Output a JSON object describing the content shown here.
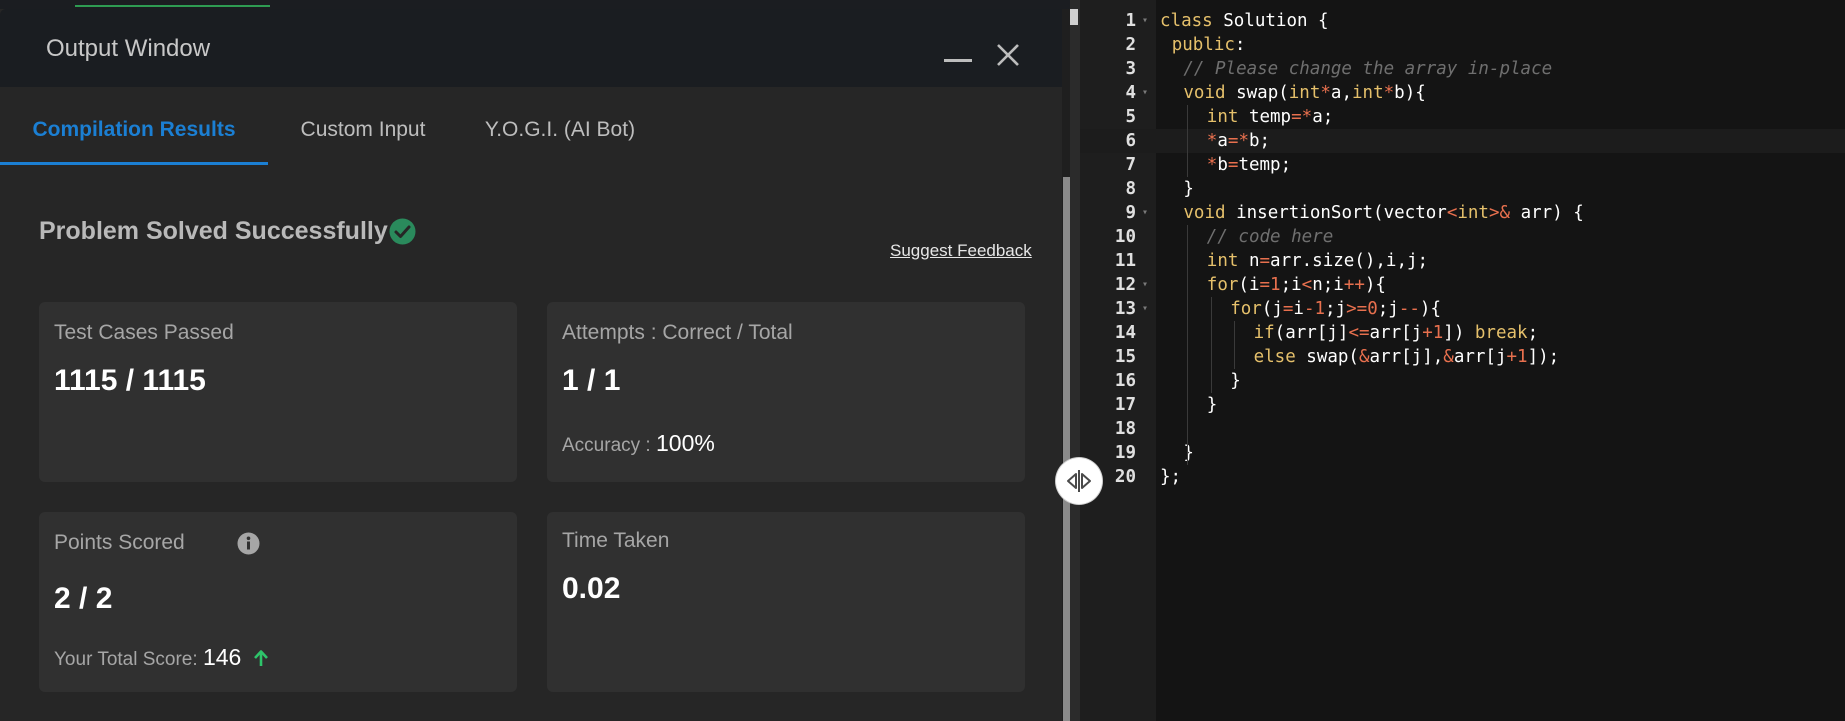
{
  "output_window": {
    "title": "Output Window",
    "tabs": [
      {
        "label": "Compilation Results",
        "active": true
      },
      {
        "label": "Custom Input",
        "active": false
      },
      {
        "label": "Y.O.G.I. (AI Bot)",
        "active": false
      }
    ],
    "status": "Problem Solved Successfully",
    "suggest_feedback": "Suggest Feedback",
    "cards": {
      "tests": {
        "label": "Test Cases Passed",
        "value": "1115 / 1115"
      },
      "attempts": {
        "label": "Attempts : Correct / Total",
        "value": "1 / 1",
        "sub_label": "Accuracy :",
        "sub_value": "100%"
      },
      "points": {
        "label": "Points Scored",
        "value": "2 / 2",
        "sub_label": "Your Total Score:",
        "sub_value": "146"
      },
      "time": {
        "label": "Time Taken",
        "value": "0.02"
      }
    }
  },
  "colors": {
    "accent_blue": "#1b7fd3",
    "success_green": "#2e9b52",
    "keyword": "#e5c06b",
    "operator": "#e8704e",
    "comment": "#6f6f6f"
  },
  "icons": [
    "minimize-icon",
    "close-icon",
    "check-circle-icon",
    "info-icon",
    "arrow-up-icon",
    "resize-handle-icon",
    "fold-arrow-icon"
  ],
  "editor": {
    "active_line": 6,
    "lines": [
      {
        "n": "1",
        "fold": true,
        "indent": 0,
        "tokens": [
          [
            "kw",
            "class"
          ],
          [
            "t",
            " Solution {"
          ]
        ]
      },
      {
        "n": "2",
        "fold": false,
        "indent": 1,
        "tokens": [
          [
            "kw",
            "public"
          ],
          [
            "t",
            ":"
          ]
        ]
      },
      {
        "n": "3",
        "fold": false,
        "indent": 2,
        "tokens": [
          [
            "cm",
            "// Please change the array in-place"
          ]
        ]
      },
      {
        "n": "4",
        "fold": true,
        "indent": 2,
        "tokens": [
          [
            "kw",
            "void"
          ],
          [
            "t",
            " swap("
          ],
          [
            "kw",
            "int"
          ],
          [
            "op",
            "*"
          ],
          [
            "t",
            "a,"
          ],
          [
            "kw",
            "int"
          ],
          [
            "op",
            "*"
          ],
          [
            "t",
            "b){"
          ]
        ]
      },
      {
        "n": "5",
        "fold": false,
        "indent": 4,
        "tokens": [
          [
            "kw",
            "int"
          ],
          [
            "t",
            " temp"
          ],
          [
            "op",
            "="
          ],
          [
            "op",
            "*"
          ],
          [
            "t",
            "a;"
          ]
        ]
      },
      {
        "n": "6",
        "fold": false,
        "indent": 4,
        "tokens": [
          [
            "op",
            "*"
          ],
          [
            "t",
            "a"
          ],
          [
            "op",
            "="
          ],
          [
            "op",
            "*"
          ],
          [
            "t",
            "b;"
          ]
        ]
      },
      {
        "n": "7",
        "fold": false,
        "indent": 4,
        "tokens": [
          [
            "op",
            "*"
          ],
          [
            "t",
            "b"
          ],
          [
            "op",
            "="
          ],
          [
            "t",
            "temp;"
          ]
        ]
      },
      {
        "n": "8",
        "fold": false,
        "indent": 2,
        "tokens": [
          [
            "t",
            "}"
          ]
        ]
      },
      {
        "n": "9",
        "fold": true,
        "indent": 2,
        "tokens": [
          [
            "kw",
            "void"
          ],
          [
            "t",
            " insertionSort(vector"
          ],
          [
            "op",
            "<"
          ],
          [
            "kw",
            "int"
          ],
          [
            "op",
            ">&"
          ],
          [
            "t",
            " arr) {"
          ]
        ]
      },
      {
        "n": "10",
        "fold": false,
        "indent": 4,
        "tokens": [
          [
            "cm",
            "// code here"
          ]
        ]
      },
      {
        "n": "11",
        "fold": false,
        "indent": 4,
        "tokens": [
          [
            "kw",
            "int"
          ],
          [
            "t",
            " n"
          ],
          [
            "op",
            "="
          ],
          [
            "t",
            "arr.size(),i,j;"
          ]
        ]
      },
      {
        "n": "12",
        "fold": true,
        "indent": 4,
        "tokens": [
          [
            "kw",
            "for"
          ],
          [
            "t",
            "(i"
          ],
          [
            "op",
            "="
          ],
          [
            "op",
            "1"
          ],
          [
            "t",
            ";i"
          ],
          [
            "op",
            "<"
          ],
          [
            "t",
            "n;i"
          ],
          [
            "op",
            "++"
          ],
          [
            "t",
            "){"
          ]
        ]
      },
      {
        "n": "13",
        "fold": true,
        "indent": 6,
        "tokens": [
          [
            "kw",
            "for"
          ],
          [
            "t",
            "(j"
          ],
          [
            "op",
            "="
          ],
          [
            "t",
            "i"
          ],
          [
            "op",
            "-1"
          ],
          [
            "t",
            ";j"
          ],
          [
            "op",
            ">="
          ],
          [
            "op",
            "0"
          ],
          [
            "t",
            ";j"
          ],
          [
            "op",
            "--"
          ],
          [
            "t",
            "){"
          ]
        ]
      },
      {
        "n": "14",
        "fold": false,
        "indent": 8,
        "tokens": [
          [
            "kw",
            "if"
          ],
          [
            "t",
            "(arr[j]"
          ],
          [
            "op",
            "<="
          ],
          [
            "t",
            "arr[j"
          ],
          [
            "op",
            "+1"
          ],
          [
            "t",
            "]) "
          ],
          [
            "kw",
            "break"
          ],
          [
            "t",
            ";"
          ]
        ]
      },
      {
        "n": "15",
        "fold": false,
        "indent": 8,
        "tokens": [
          [
            "kw",
            "else"
          ],
          [
            "t",
            " swap("
          ],
          [
            "op",
            "&"
          ],
          [
            "t",
            "arr[j],"
          ],
          [
            "op",
            "&"
          ],
          [
            "t",
            "arr[j"
          ],
          [
            "op",
            "+1"
          ],
          [
            "t",
            "]);"
          ]
        ]
      },
      {
        "n": "16",
        "fold": false,
        "indent": 6,
        "tokens": [
          [
            "t",
            "}"
          ]
        ]
      },
      {
        "n": "17",
        "fold": false,
        "indent": 4,
        "tokens": [
          [
            "t",
            "}"
          ]
        ]
      },
      {
        "n": "18",
        "fold": false,
        "indent": 0,
        "tokens": []
      },
      {
        "n": "19",
        "fold": false,
        "indent": 2,
        "tokens": [
          [
            "t",
            "}"
          ]
        ]
      },
      {
        "n": "20",
        "fold": false,
        "indent": 0,
        "tokens": [
          [
            "t",
            "};"
          ]
        ]
      }
    ]
  }
}
